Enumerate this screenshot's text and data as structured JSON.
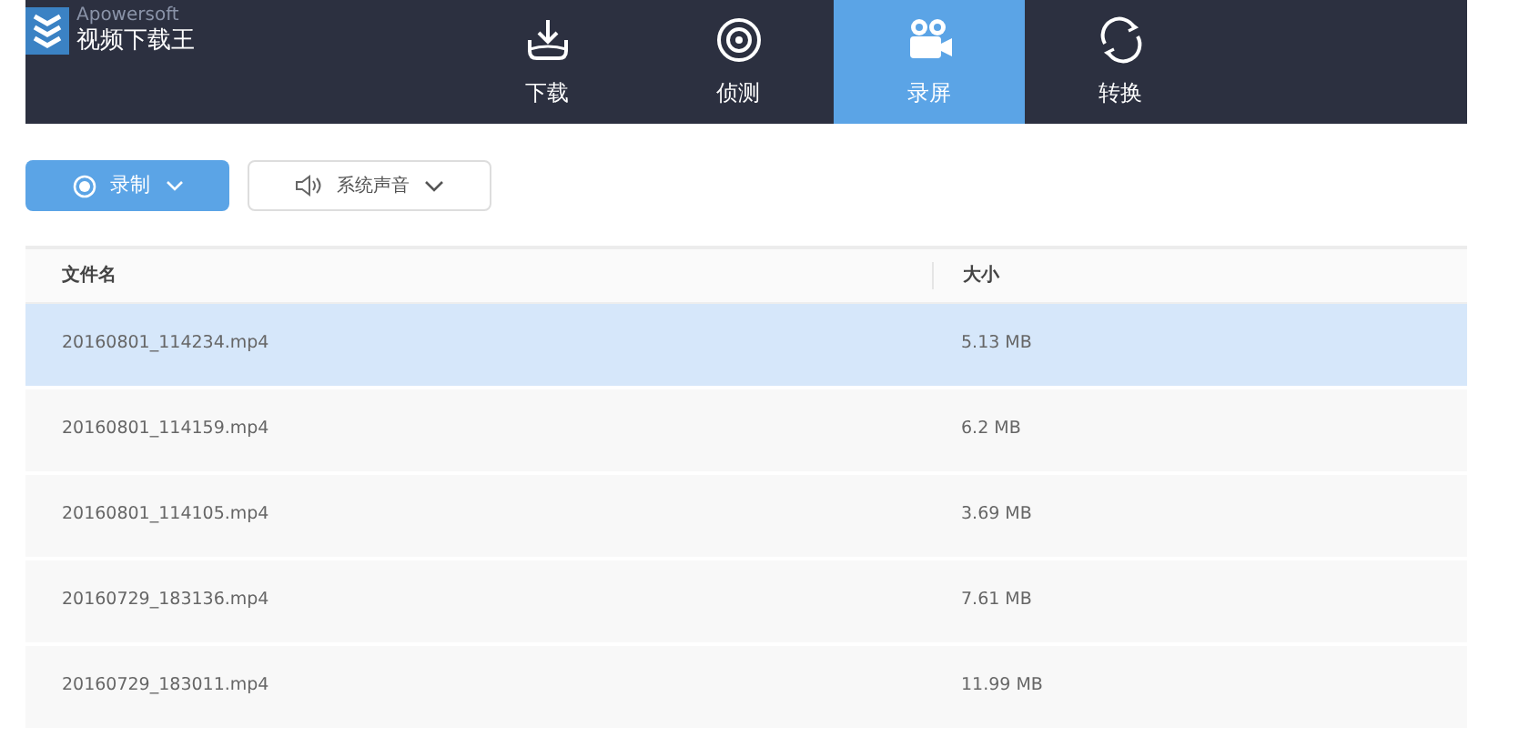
{
  "app": {
    "brand": "Apowersoft",
    "title": "视频下载王"
  },
  "tabs": [
    {
      "label": "下载",
      "kind": "download",
      "selected": false
    },
    {
      "label": "侦测",
      "kind": "detect",
      "selected": false
    },
    {
      "label": "录屏",
      "kind": "record",
      "selected": true
    },
    {
      "label": "转换",
      "kind": "convert",
      "selected": false
    }
  ],
  "toolbar": {
    "record_button": "录制",
    "audio_button": "系统声音"
  },
  "table": {
    "columns": [
      "文件名",
      "大小"
    ],
    "rows": [
      {
        "name": "20160801_114234.mp4",
        "size": "5.13 MB",
        "selected": true
      },
      {
        "name": "20160801_114159.mp4",
        "size": "6.2 MB",
        "selected": false
      },
      {
        "name": "20160801_114105.mp4",
        "size": "3.69 MB",
        "selected": false
      },
      {
        "name": "20160729_183136.mp4",
        "size": "7.61 MB",
        "selected": false
      },
      {
        "name": "20160729_183011.mp4",
        "size": "11.99 MB",
        "selected": false
      }
    ]
  }
}
